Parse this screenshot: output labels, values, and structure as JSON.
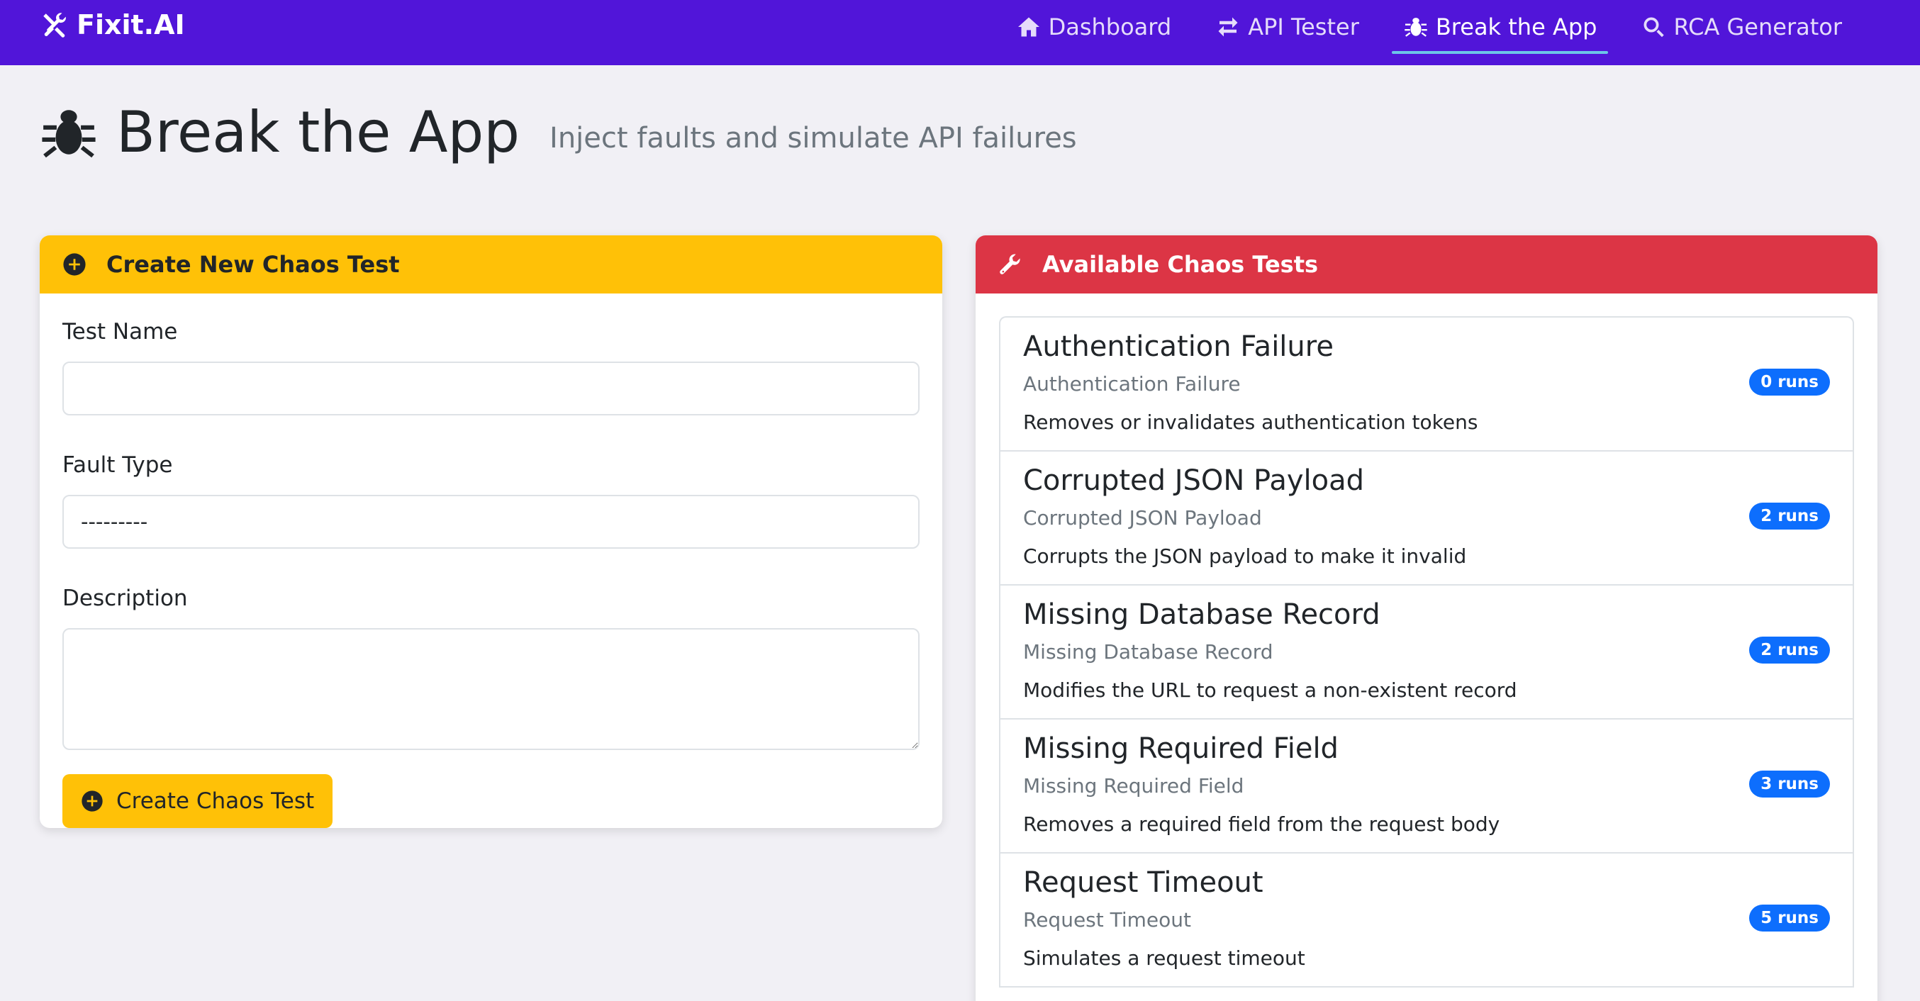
{
  "nav": {
    "brand": "Fixit.AI",
    "links": [
      {
        "label": "Dashboard",
        "icon": "home-icon"
      },
      {
        "label": "API Tester",
        "icon": "exchange-icon"
      },
      {
        "label": "Break the App",
        "icon": "bug-icon",
        "active": true
      },
      {
        "label": "RCA Generator",
        "icon": "search-icon"
      }
    ]
  },
  "header": {
    "title": "Break the App",
    "subtitle": "Inject faults and simulate API failures"
  },
  "create_card": {
    "title": "Create New Chaos Test",
    "test_name_label": "Test Name",
    "test_name_value": "",
    "fault_type_label": "Fault Type",
    "fault_type_value": "---------",
    "description_label": "Description",
    "description_value": "",
    "submit_label": "Create Chaos Test"
  },
  "tests_card": {
    "title": "Available Chaos Tests",
    "items": [
      {
        "title": "Authentication Failure",
        "subtitle": "Authentication Failure",
        "description": "Removes or invalidates authentication tokens",
        "runs": "0 runs"
      },
      {
        "title": "Corrupted JSON Payload",
        "subtitle": "Corrupted JSON Payload",
        "description": "Corrupts the JSON payload to make it invalid",
        "runs": "2 runs"
      },
      {
        "title": "Missing Database Record",
        "subtitle": "Missing Database Record",
        "description": "Modifies the URL to request a non-existent record",
        "runs": "2 runs"
      },
      {
        "title": "Missing Required Field",
        "subtitle": "Missing Required Field",
        "description": "Removes a required field from the request body",
        "runs": "3 runs"
      },
      {
        "title": "Request Timeout",
        "subtitle": "Request Timeout",
        "description": "Simulates a request timeout",
        "runs": "5 runs"
      }
    ]
  },
  "colors": {
    "navbar": "#5115d9",
    "warning": "#ffc107",
    "danger": "#dc3545",
    "badge": "#0d6efd",
    "active_underline": "#6cc5e8"
  }
}
